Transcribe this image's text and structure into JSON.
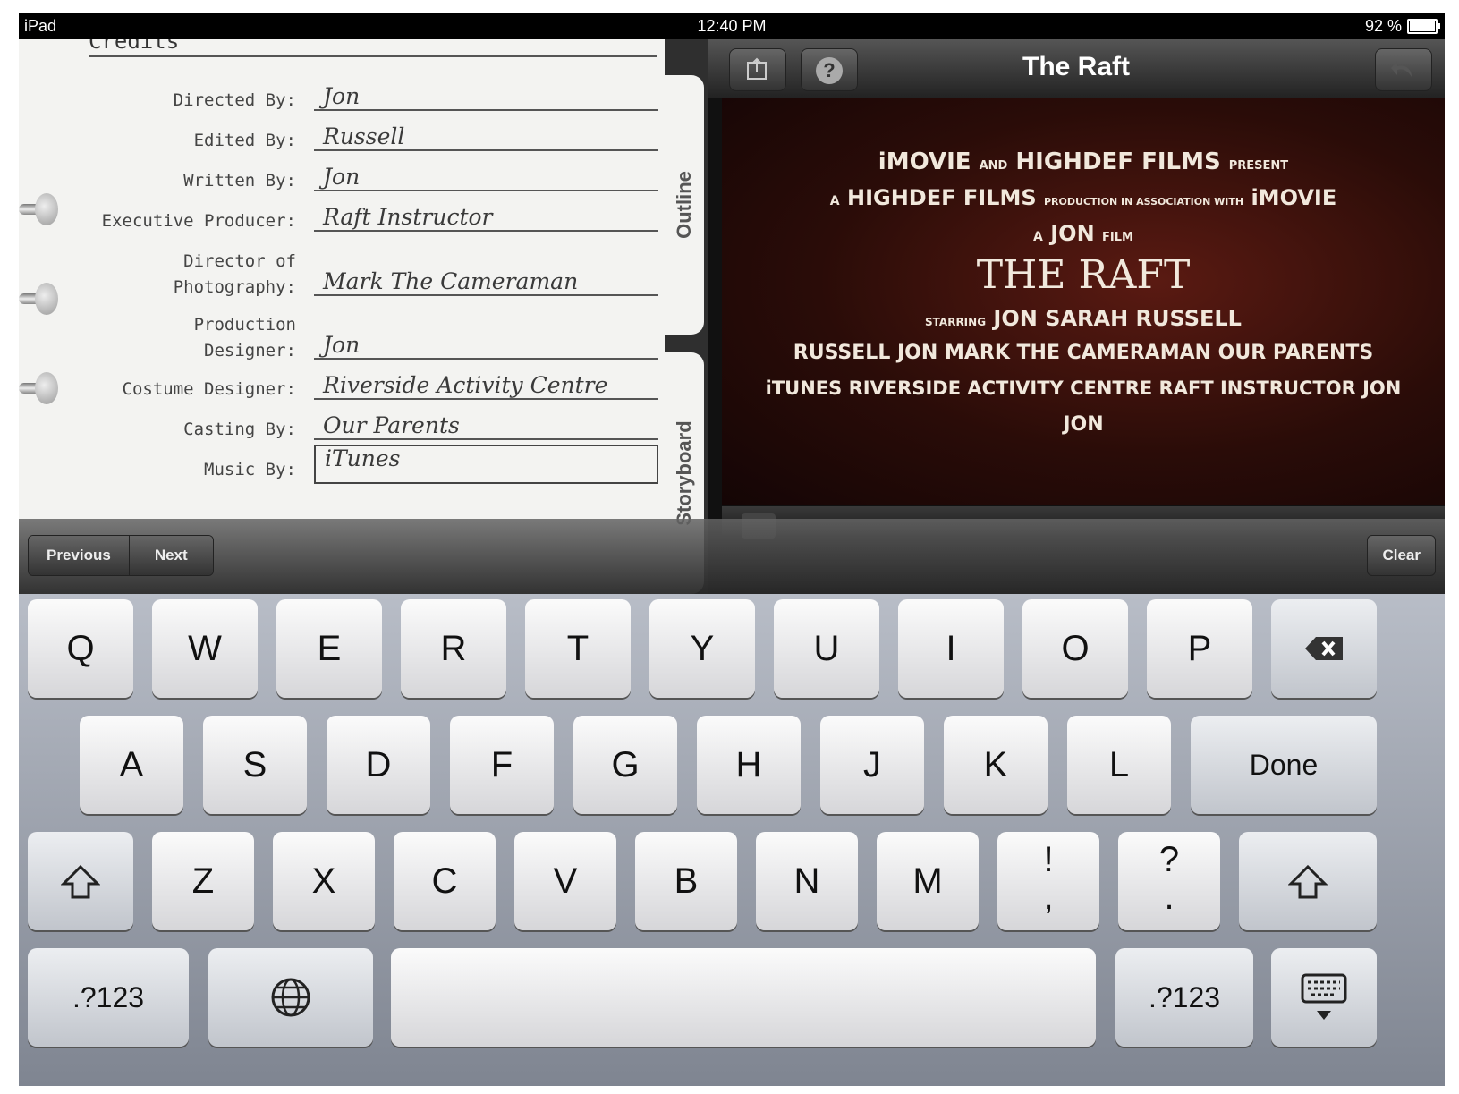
{
  "status_bar": {
    "device": "iPad",
    "time": "12:40 PM",
    "battery": "92 %",
    "battery_level": 0.92
  },
  "notebook": {
    "heading": "Credits",
    "rows": [
      {
        "label": "Directed By:",
        "value": "Jon"
      },
      {
        "label": "Edited By:",
        "value": "Russell"
      },
      {
        "label": "Written By:",
        "value": "Jon"
      },
      {
        "label": "Executive Producer:",
        "value": "Raft Instructor"
      },
      {
        "label_line1": "Director of",
        "label_line2": "Photography:",
        "value": "Mark The Cameraman"
      },
      {
        "label_line1": "Production",
        "label_line2": "Designer:",
        "value": "Jon"
      },
      {
        "label": "Costume Designer:",
        "value": "Riverside Activity Centre"
      },
      {
        "label": "Casting By:",
        "value": "Our Parents"
      },
      {
        "label": "Music By:",
        "value": "iTunes"
      }
    ],
    "tabs": {
      "outline": "Outline",
      "storyboard": "Storyboard"
    }
  },
  "preview": {
    "title": "The Raft",
    "toolbar_icons": [
      "export-icon",
      "help-icon",
      "undo-icon"
    ],
    "help_glyph": "?",
    "credits": {
      "line1_a": "iMOVIE",
      "line1_b": "AND",
      "line1_c": "HIGHDEF FILMS",
      "line1_d": "PRESENT",
      "line2_a": "A",
      "line2_b": "HIGHDEF FILMS",
      "line2_c": "PRODUCTION IN ASSOCIATION WITH",
      "line2_d": "iMOVIE",
      "line3_a": "A",
      "line3_b": "JON",
      "line3_c": "FILM",
      "movie_title": "THE RAFT",
      "starring_label": "STARRING",
      "starring": "JON  SARAH  RUSSELL",
      "block1": "RUSSELL  JON  MARK THE CAMERAMAN  OUR PARENTS",
      "block2": "iTUNES  RIVERSIDE ACTIVITY CENTRE  RAFT INSTRUCTOR  JON",
      "block3": "JON"
    }
  },
  "accessory_bar": {
    "previous": "Previous",
    "next": "Next",
    "clear": "Clear"
  },
  "keyboard": {
    "row1": [
      "Q",
      "W",
      "E",
      "R",
      "T",
      "Y",
      "U",
      "I",
      "O",
      "P"
    ],
    "row2": [
      "A",
      "S",
      "D",
      "F",
      "G",
      "H",
      "J",
      "K",
      "L"
    ],
    "row3": [
      "Z",
      "X",
      "C",
      "V",
      "B",
      "N",
      "M"
    ],
    "done": "Done",
    "excl_top": "!",
    "excl_bottom": ",",
    "quest_top": "?",
    "quest_bottom": ".",
    "numbers_left": ".?123",
    "numbers_right": ".?123"
  }
}
